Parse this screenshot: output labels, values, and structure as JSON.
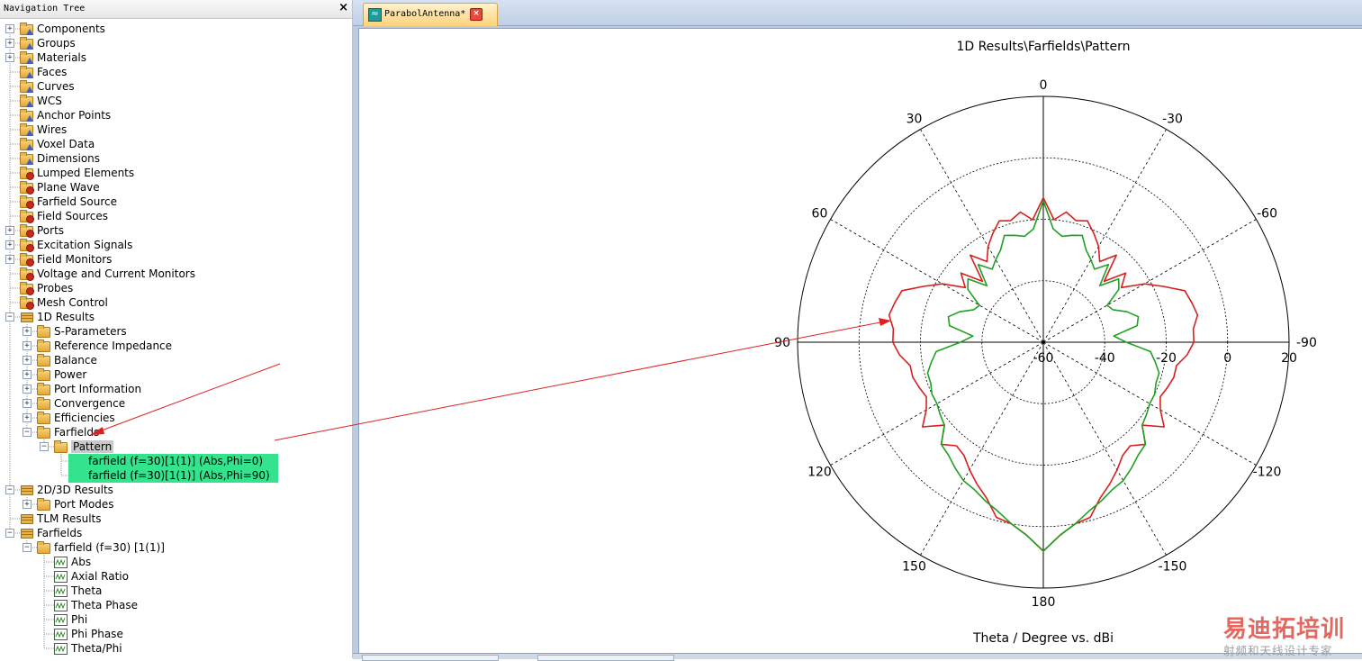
{
  "nav": {
    "title": "Navigation Tree",
    "close_icon": "×",
    "items": [
      {
        "label": "Components",
        "icon": "folder-tri",
        "toggle": "+"
      },
      {
        "label": "Groups",
        "icon": "folder-tri",
        "toggle": "+"
      },
      {
        "label": "Materials",
        "icon": "folder-tri",
        "toggle": "+"
      },
      {
        "label": "Faces",
        "icon": "folder-tri",
        "toggle": ""
      },
      {
        "label": "Curves",
        "icon": "folder-tri",
        "toggle": ""
      },
      {
        "label": "WCS",
        "icon": "folder-tri",
        "toggle": ""
      },
      {
        "label": "Anchor Points",
        "icon": "folder-tri",
        "toggle": ""
      },
      {
        "label": "Wires",
        "icon": "folder-tri",
        "toggle": ""
      },
      {
        "label": "Voxel Data",
        "icon": "folder-tri",
        "toggle": ""
      },
      {
        "label": "Dimensions",
        "icon": "folder-tri",
        "toggle": ""
      },
      {
        "label": "Lumped Elements",
        "icon": "folder-gear",
        "toggle": ""
      },
      {
        "label": "Plane Wave",
        "icon": "folder-gear",
        "toggle": ""
      },
      {
        "label": "Farfield Source",
        "icon": "folder-gear",
        "toggle": ""
      },
      {
        "label": "Field Sources",
        "icon": "folder-gear",
        "toggle": ""
      },
      {
        "label": "Ports",
        "icon": "folder-gear",
        "toggle": "+"
      },
      {
        "label": "Excitation Signals",
        "icon": "folder-gear",
        "toggle": "+"
      },
      {
        "label": "Field Monitors",
        "icon": "folder-gear",
        "toggle": "+"
      },
      {
        "label": "Voltage and Current Monitors",
        "icon": "folder-gear",
        "toggle": ""
      },
      {
        "label": "Probes",
        "icon": "folder-gear",
        "toggle": ""
      },
      {
        "label": "Mesh Control",
        "icon": "folder-gear",
        "toggle": ""
      },
      {
        "label": "1D Results",
        "icon": "stack",
        "toggle": "−"
      },
      {
        "label": "S-Parameters",
        "icon": "folder",
        "toggle": "+"
      },
      {
        "label": "Reference Impedance",
        "icon": "folder",
        "toggle": "+"
      },
      {
        "label": "Balance",
        "icon": "folder",
        "toggle": "+"
      },
      {
        "label": "Power",
        "icon": "folder",
        "toggle": "+"
      },
      {
        "label": "Port Information",
        "icon": "folder",
        "toggle": "+"
      },
      {
        "label": "Convergence",
        "icon": "folder",
        "toggle": "+"
      },
      {
        "label": "Efficiencies",
        "icon": "folder",
        "toggle": "+"
      },
      {
        "label": "Farfields",
        "icon": "folder",
        "toggle": "−"
      },
      {
        "label": "Pattern",
        "icon": "folder",
        "toggle": "−"
      },
      {
        "label": "farfield (f=30)[1(1)] (Abs,Phi=0)",
        "icon": "result",
        "toggle": ""
      },
      {
        "label": "farfield (f=30)[1(1)] (Abs,Phi=90)",
        "icon": "result",
        "toggle": ""
      },
      {
        "label": "2D/3D Results",
        "icon": "stack",
        "toggle": "−"
      },
      {
        "label": "Port Modes",
        "icon": "folder",
        "toggle": "+"
      },
      {
        "label": "TLM Results",
        "icon": "stack",
        "toggle": ""
      },
      {
        "label": "Farfields",
        "icon": "stack",
        "toggle": "−"
      },
      {
        "label": "farfield (f=30) [1(1)]",
        "icon": "folder",
        "toggle": "−"
      },
      {
        "label": "Abs",
        "icon": "result",
        "toggle": ""
      },
      {
        "label": "Axial Ratio",
        "icon": "result",
        "toggle": ""
      },
      {
        "label": "Theta",
        "icon": "result",
        "toggle": ""
      },
      {
        "label": "Theta Phase",
        "icon": "result",
        "toggle": ""
      },
      {
        "label": "Phi",
        "icon": "result",
        "toggle": ""
      },
      {
        "label": "Phi Phase",
        "icon": "result",
        "toggle": ""
      },
      {
        "label": "Theta/Phi",
        "icon": "result",
        "toggle": ""
      }
    ]
  },
  "editor": {
    "tab_label": "ParabolAntenna*",
    "tab_close_icon": "×",
    "tab_icon": "≈"
  },
  "chart_data": {
    "type": "polar",
    "title": "1D Results\\Farfields\\Pattern",
    "xlabel": "Theta / Degree vs. dBi",
    "angle_labels": [
      "0",
      "30",
      "60",
      "90",
      "120",
      "150",
      "180",
      "-150",
      "-120",
      "-90",
      "-60",
      "-30"
    ],
    "angle_values": [
      0,
      30,
      60,
      90,
      120,
      150,
      180,
      -150,
      -120,
      -90,
      -60,
      -30
    ],
    "radial_labels": [
      "-60",
      "-40",
      "-20",
      "0",
      "20"
    ],
    "radial_values": [
      -60,
      -40,
      -20,
      0,
      20
    ],
    "rlim": [
      -60,
      20
    ],
    "grid": true,
    "series": [
      {
        "color": "#d81f1f",
        "theta": [
          0,
          5,
          10,
          15,
          20,
          25,
          30,
          35,
          40,
          45,
          50,
          55,
          60,
          65,
          70,
          75,
          80,
          85,
          90,
          95,
          100,
          105,
          110,
          115,
          120,
          125,
          130,
          135,
          140,
          145,
          150,
          155,
          160,
          165,
          170,
          175,
          180
        ],
        "values": [
          -13,
          -20,
          -17,
          -19,
          -18,
          -21,
          -24,
          -28,
          -23,
          -32,
          -25,
          -29,
          -22,
          -17,
          -11,
          -10,
          -9,
          -11,
          -11,
          -13,
          -16,
          -16,
          -17,
          -18,
          -16,
          -12,
          -18,
          -13,
          -16,
          -15,
          -12,
          -9,
          -6,
          -1,
          0,
          3,
          8
        ]
      },
      {
        "color": "#22a022",
        "theta": [
          0,
          5,
          10,
          15,
          20,
          25,
          30,
          35,
          40,
          45,
          50,
          55,
          60,
          65,
          70,
          75,
          80,
          85,
          90,
          95,
          100,
          105,
          110,
          115,
          120,
          125,
          130,
          135,
          140,
          145,
          150,
          155,
          160,
          165,
          170,
          175,
          180
        ],
        "values": [
          -14,
          -23,
          -25,
          -24,
          -23,
          -27,
          -29,
          -31,
          -27,
          -34,
          -28,
          -30,
          -36,
          -35,
          -31,
          -28,
          -29,
          -37,
          -33,
          -25,
          -23,
          -21,
          -21,
          -20,
          -20,
          -19,
          -18,
          -13,
          -12,
          -10,
          -8,
          -7,
          -5,
          -3,
          0,
          3,
          8
        ]
      }
    ]
  },
  "watermark": {
    "line1": "易迪拓培训",
    "line2": "射频和天线设计专家"
  }
}
